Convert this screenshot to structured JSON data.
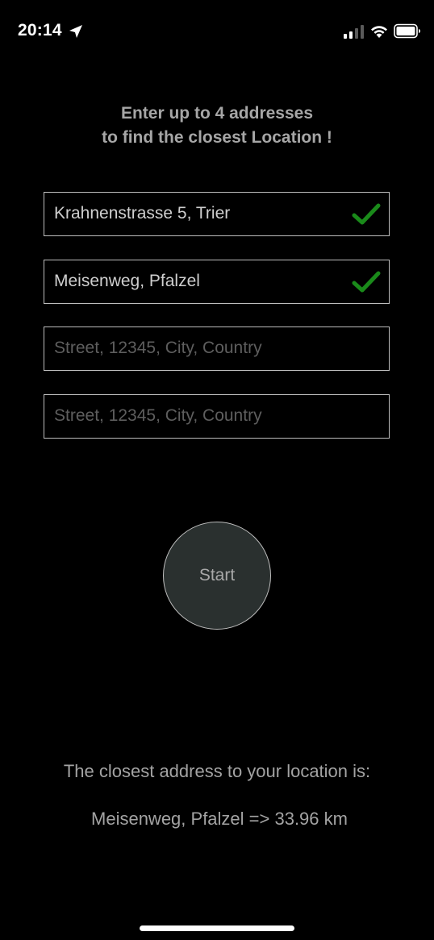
{
  "status_bar": {
    "time": "20:14",
    "icons": [
      "location-arrow-icon",
      "cellular-signal-icon",
      "wifi-icon",
      "battery-icon"
    ]
  },
  "heading": {
    "line1": "Enter up to 4 addresses",
    "line2": "to find the closest Location !"
  },
  "addresses": [
    {
      "value": "Krahnenstrasse 5, Trier",
      "placeholder": "",
      "valid": true
    },
    {
      "value": "Meisenweg, Pfalzel",
      "placeholder": "",
      "valid": true
    },
    {
      "value": "",
      "placeholder": "Street, 12345, City, Country",
      "valid": false
    },
    {
      "value": "",
      "placeholder": "Street, 12345, City, Country",
      "valid": false
    }
  ],
  "start_button": {
    "label": "Start"
  },
  "result": {
    "label": "The closest address to your location is:",
    "value": "Meisenweg, Pfalzel => 33.96 km"
  },
  "colors": {
    "background": "#000000",
    "text_muted": "#a6a6a6",
    "field_border": "#bdbdbd",
    "check_green": "#1a8a1a",
    "button_fill": "#2a302f"
  }
}
